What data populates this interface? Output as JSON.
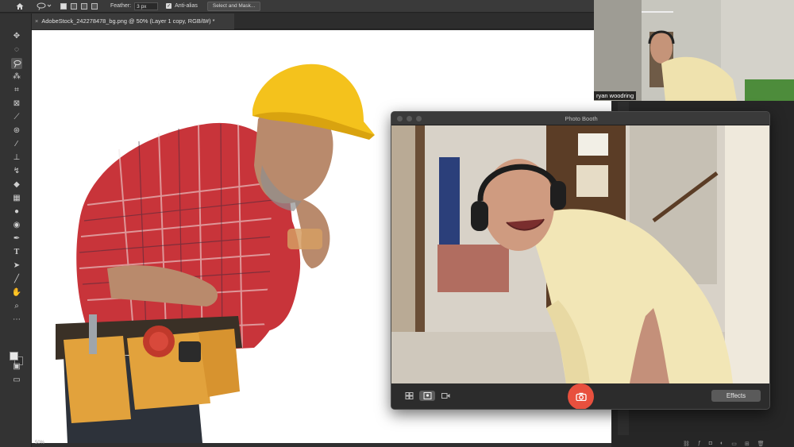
{
  "options_bar": {
    "feather_label": "Feather:",
    "feather_value": "3 px",
    "antialias_label": "Anti-alias",
    "antialias_checked": true,
    "select_mask_label": "Select and Mask..."
  },
  "document": {
    "tab_title": "AdobeStock_242278478_bg.png @ 50% (Layer 1 copy, RGB/8#) *",
    "zoom": "50%"
  },
  "toolbar": {
    "tools": [
      "move-tool",
      "marquee-tool",
      "lasso-tool",
      "quick-selection-tool",
      "crop-tool",
      "frame-tool",
      "eyedropper-tool",
      "healing-tool",
      "brush-tool",
      "clone-stamp-tool",
      "history-brush-tool",
      "eraser-tool",
      "gradient-tool",
      "blur-tool",
      "dodge-tool",
      "pen-tool",
      "type-tool",
      "path-selection-tool",
      "line-tool",
      "hand-tool",
      "zoom-tool",
      "more-tools"
    ],
    "active_tool": "lasso-tool",
    "foreground_color": "#e8e8e8",
    "background_color": "#2b2b2b"
  },
  "webcam": {
    "participant_name": "ryan woodring"
  },
  "photo_booth": {
    "title": "Photo Booth",
    "effects_label": "Effects",
    "shutter_color": "#e8503e",
    "active_view": "single-photo"
  },
  "colors": {
    "app_bg": "#2b2b2b",
    "canvas": "#ffffff",
    "hard_hat": "#f4c21c",
    "shirt": "#c8343a",
    "tool_belt": "#e2a23c"
  }
}
